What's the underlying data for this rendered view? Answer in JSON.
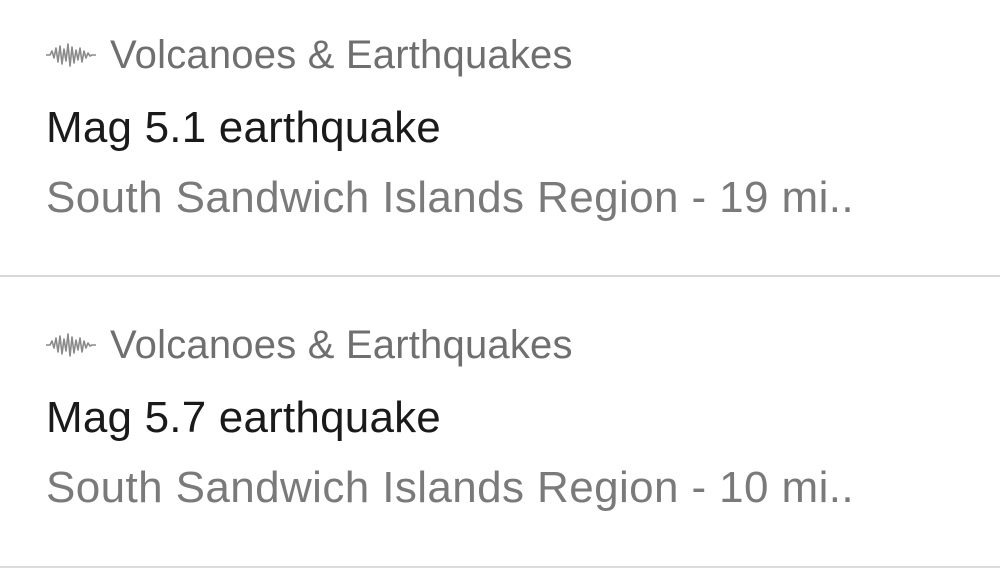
{
  "notifications": [
    {
      "app_name": "Volcanoes & Earthquakes",
      "app_icon": "seismograph-icon",
      "title": "Mag 5.1 earthquake",
      "subtitle": "South Sandwich Islands Region - 19 mi.."
    },
    {
      "app_name": "Volcanoes & Earthquakes",
      "app_icon": "seismograph-icon",
      "title": "Mag 5.7 earthquake",
      "subtitle": "South Sandwich Islands Region - 10 mi.."
    }
  ],
  "colors": {
    "app_name": "#6f6f6f",
    "title": "#1a1a1a",
    "subtitle": "#7a7a7a",
    "divider": "#d7d7d7",
    "background": "#ffffff"
  }
}
